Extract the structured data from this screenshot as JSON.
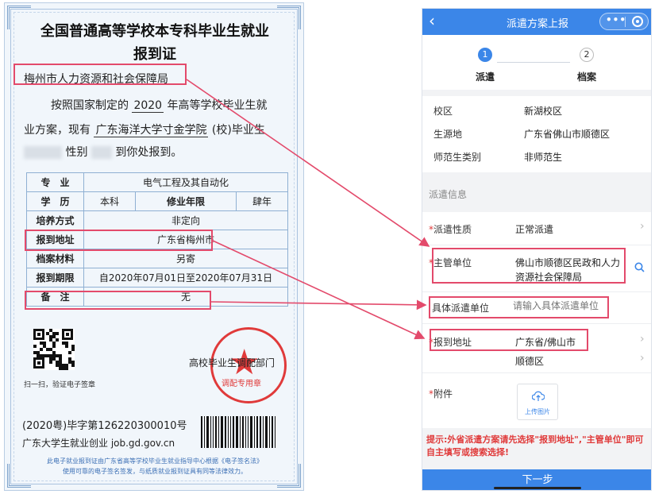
{
  "certificate": {
    "title_line1": "全国普通高等学校本专科毕业生就业",
    "title_line2": "报到证",
    "recipient": "梅州市人力资源和社会保障局",
    "body": {
      "p1_a": "按照国家制定的",
      "year": "2020",
      "p1_b": "年高等学校毕业生就",
      "p2_a": "业方案，现有",
      "school": "广东海洋大学寸金学院",
      "p2_b": "(校)毕业生",
      "p3_a": "性别",
      "p3_b": "到你处报到。"
    },
    "table": {
      "major_label": "专　业",
      "major_value": "电气工程及其自动化",
      "degree_label": "学　历",
      "degree_value": "本科",
      "years_label": "修业年限",
      "years_value": "肆年",
      "training_label": "培养方式",
      "training_value": "非定向",
      "report_addr_label": "报到地址",
      "report_addr_value": "广东省梅州市",
      "archive_label": "档案材料",
      "archive_value": "另寄",
      "period_label": "报到期限",
      "period_value": "自2020年07月01日至2020年07月31日",
      "remark_label": "备　注",
      "remark_value": "无"
    },
    "issuer": "高校毕业生调配部门",
    "seal_text": "调配专用章",
    "qr_caption": "扫一扫，验证电子签章",
    "cert_number": "(2020粤)毕字第126220300010号",
    "website": "广东大学生就业创业 job.gd.gov.cn",
    "footer_line1": "此电子就业报到证由广东省高等学校毕业生就业指导中心根据《电子签名法》",
    "footer_line2": "使用可靠的电子签名签发，与纸质就业报到证具有同等法律效力。"
  },
  "phone": {
    "header_title": "派遣方案上报",
    "back_icon": "chevron-left-icon",
    "steps": [
      {
        "num": "1",
        "label": "派遣",
        "active": true
      },
      {
        "num": "2",
        "label": "档案",
        "active": false
      }
    ],
    "info": [
      {
        "key": "校区",
        "value": "新湖校区"
      },
      {
        "key": "生源地",
        "value": "广东省佛山市顺德区"
      },
      {
        "key": "师范生类别",
        "value": "非师范生"
      }
    ],
    "section_title": "派遣信息",
    "dispatch_type_label": "派遣性质",
    "dispatch_type_value": "正常派遣",
    "supervisor_label": "主管单位",
    "supervisor_value_1": "佛山市顺德区民政和人力",
    "supervisor_value_2": "资源社会保障局",
    "specific_unit_label": "具体派遣单位",
    "specific_unit_placeholder": "请输入具体派遣单位",
    "report_addr_label": "报到地址",
    "report_addr_value_1": "广东省/佛山市",
    "report_addr_value_2": "顺德区",
    "attachment_label": "附件",
    "upload_label": "上传图片",
    "tip": "提示:外省派遣方案请先选择\"报到地址\",\"主管单位\"即可自主填写或搜索选择!",
    "next_button": "下一步",
    "colors": {
      "primary": "#3b86e8",
      "highlight": "#e34a6b",
      "required": "#e03a3a"
    }
  }
}
